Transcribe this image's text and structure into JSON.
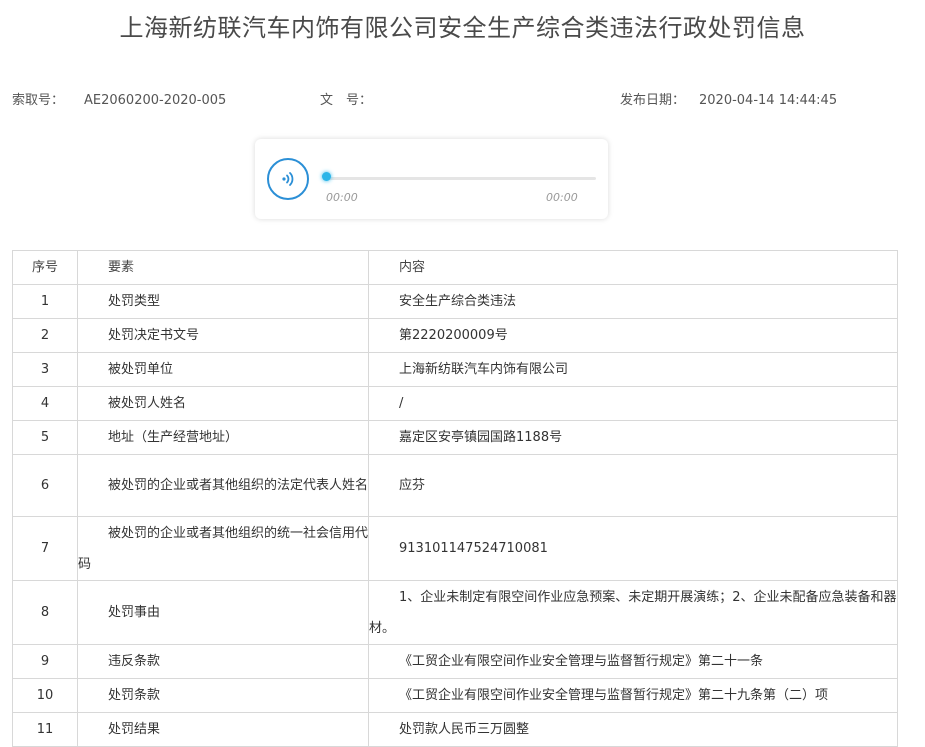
{
  "title": "上海新纺联汽车内饰有限公司安全生产综合类违法行政处罚信息",
  "meta": {
    "index_label": "索取号：",
    "index_value": "AE2060200-2020-005",
    "docno_label": "文　号：",
    "docno_value": "",
    "date_label": "发布日期：",
    "date_value": "2020-04-14 14:44:45"
  },
  "player": {
    "current_time": "00:00",
    "duration": "00:00",
    "progress": 0,
    "play_icon": "audio-wave-icon",
    "accent_color": "#2b8fd6"
  },
  "table": {
    "headers": [
      "序号",
      "要素",
      "内容"
    ],
    "rows": [
      {
        "no": "1",
        "key": "处罚类型",
        "value": "安全生产综合类违法"
      },
      {
        "no": "2",
        "key": "处罚决定书文号",
        "value": "第2220200009号"
      },
      {
        "no": "3",
        "key": "被处罚单位",
        "value": "上海新纺联汽车内饰有限公司"
      },
      {
        "no": "4",
        "key": "被处罚人姓名",
        "value": "/"
      },
      {
        "no": "5",
        "key": "地址（生产经营地址）",
        "value": "嘉定区安亭镇园国路1188号"
      },
      {
        "no": "6",
        "key": "被处罚的企业或者其他组织的法定代表人姓名",
        "value": "应芬"
      },
      {
        "no": "7",
        "key": "被处罚的企业或者其他组织的统一社会信用代码",
        "value": "913101147524710081"
      },
      {
        "no": "8",
        "key": "处罚事由",
        "value": "1、企业未制定有限空间作业应急预案、未定期开展演练；2、企业未配备应急装备和器材。"
      },
      {
        "no": "9",
        "key": "违反条款",
        "value": "《工贸企业有限空间作业安全管理与监督暂行规定》第二十一条"
      },
      {
        "no": "10",
        "key": "处罚条款",
        "value": "《工贸企业有限空间作业安全管理与监督暂行规定》第二十九条第（二）项"
      },
      {
        "no": "11",
        "key": "处罚结果",
        "value": "处罚款人民币三万圆整"
      }
    ]
  }
}
